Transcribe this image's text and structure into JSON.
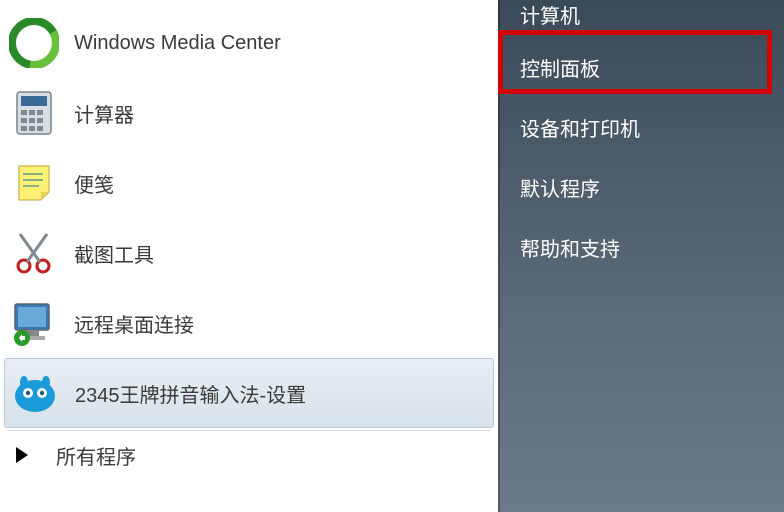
{
  "left_panel": {
    "items": [
      {
        "label": "Windows Media Center",
        "icon": "media-center"
      },
      {
        "label": "计算器",
        "icon": "calculator"
      },
      {
        "label": "便笺",
        "icon": "sticky-notes"
      },
      {
        "label": "截图工具",
        "icon": "snipping-tool"
      },
      {
        "label": "远程桌面连接",
        "icon": "remote-desktop"
      },
      {
        "label": "2345王牌拼音输入法-设置",
        "icon": "ime-2345",
        "highlighted": true
      }
    ],
    "all_programs_label": "所有程序"
  },
  "right_panel": {
    "items": [
      {
        "label": "计算机"
      },
      {
        "label": "控制面板",
        "highlighted": true
      },
      {
        "label": "设备和打印机"
      },
      {
        "label": "默认程序"
      },
      {
        "label": "帮助和支持"
      }
    ]
  }
}
